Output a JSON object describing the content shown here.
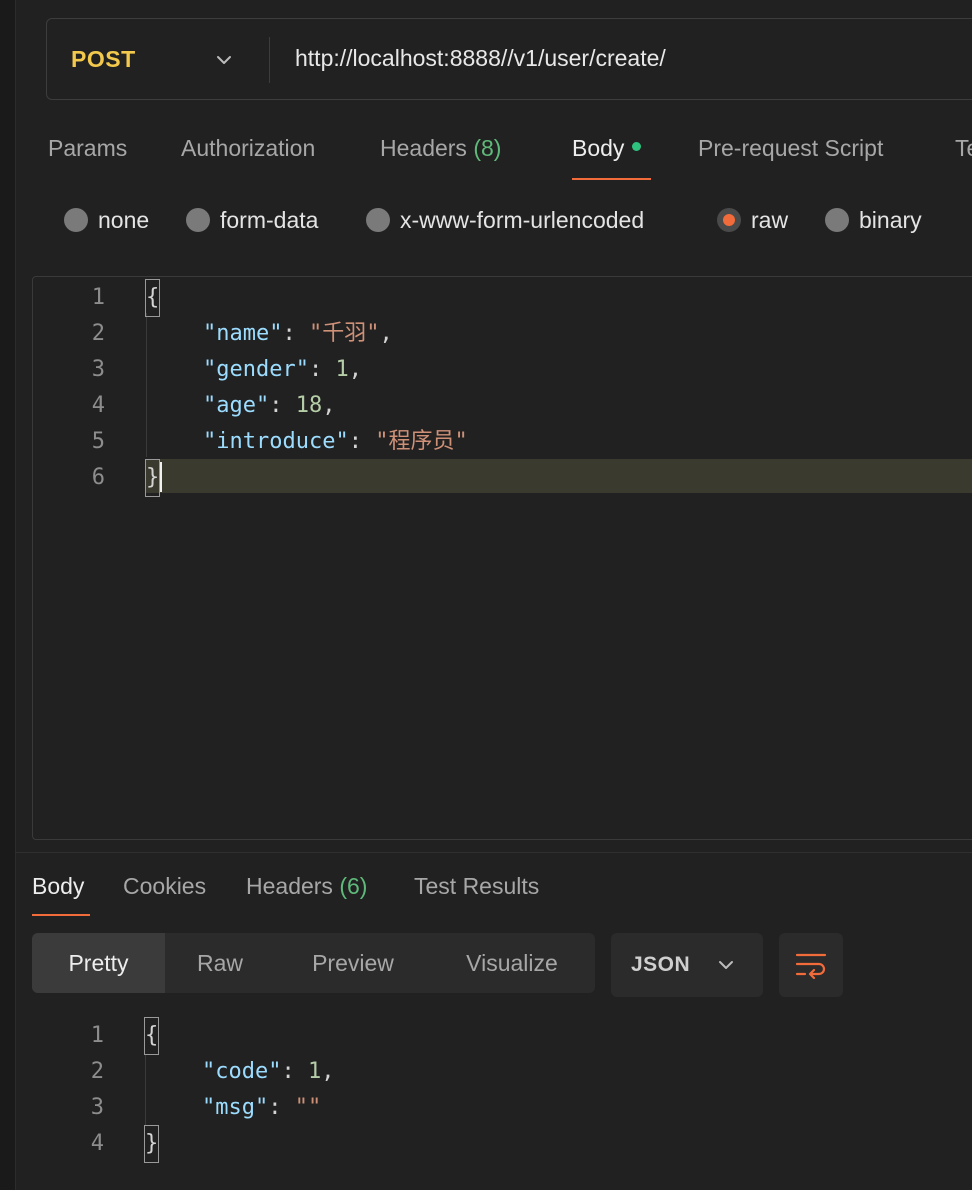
{
  "request": {
    "method": "POST",
    "url": "http://localhost:8888//v1/user/create/"
  },
  "request_tabs": [
    {
      "label": "Params"
    },
    {
      "label": "Authorization"
    },
    {
      "label": "Headers",
      "count": "(8)"
    },
    {
      "label": "Body",
      "active": true
    },
    {
      "label": "Pre-request Script"
    },
    {
      "label": "Te"
    }
  ],
  "body_types": [
    {
      "label": "none"
    },
    {
      "label": "form-data"
    },
    {
      "label": "x-www-form-urlencoded"
    },
    {
      "label": "raw",
      "selected": true
    },
    {
      "label": "binary"
    }
  ],
  "request_body_lines": [
    {
      "num": "1",
      "text": "{"
    },
    {
      "num": "2",
      "key": "\"name\"",
      "sep": ": ",
      "value": "\"千羽\"",
      "value_type": "string",
      "trail": ","
    },
    {
      "num": "3",
      "key": "\"gender\"",
      "sep": ": ",
      "value": "1",
      "value_type": "number",
      "trail": ","
    },
    {
      "num": "4",
      "key": "\"age\"",
      "sep": ": ",
      "value": "18",
      "value_type": "number",
      "trail": ","
    },
    {
      "num": "5",
      "key": "\"introduce\"",
      "sep": ": ",
      "value": "\"程序员\"",
      "value_type": "string",
      "trail": ""
    },
    {
      "num": "6",
      "text": "}"
    }
  ],
  "response_tabs": [
    {
      "label": "Body",
      "active": true
    },
    {
      "label": "Cookies"
    },
    {
      "label": "Headers",
      "count": "(6)"
    },
    {
      "label": "Test Results"
    }
  ],
  "view_modes": [
    {
      "label": "Pretty",
      "active": true
    },
    {
      "label": "Raw"
    },
    {
      "label": "Preview"
    },
    {
      "label": "Visualize"
    }
  ],
  "format_select": {
    "value": "JSON"
  },
  "response_body_lines": [
    {
      "num": "1",
      "text": "{"
    },
    {
      "num": "2",
      "key": "\"code\"",
      "sep": ": ",
      "value": "1",
      "value_type": "number",
      "trail": ","
    },
    {
      "num": "3",
      "key": "\"msg\"",
      "sep": ": ",
      "value": "\"\"",
      "value_type": "string",
      "trail": ""
    },
    {
      "num": "4",
      "text": "}"
    }
  ],
  "colors": {
    "method": "#f2c94c",
    "accent": "#f26b3a",
    "count": "#5fb97a",
    "json_key": "#9cdcfe",
    "json_string": "#ce9178",
    "json_number": "#b5cea8"
  },
  "icons": {
    "method_dropdown": "chevron-down-icon",
    "format_dropdown": "chevron-down-icon",
    "wrap": "wrap-lines-icon",
    "body_modified": "green-dot-indicator"
  }
}
